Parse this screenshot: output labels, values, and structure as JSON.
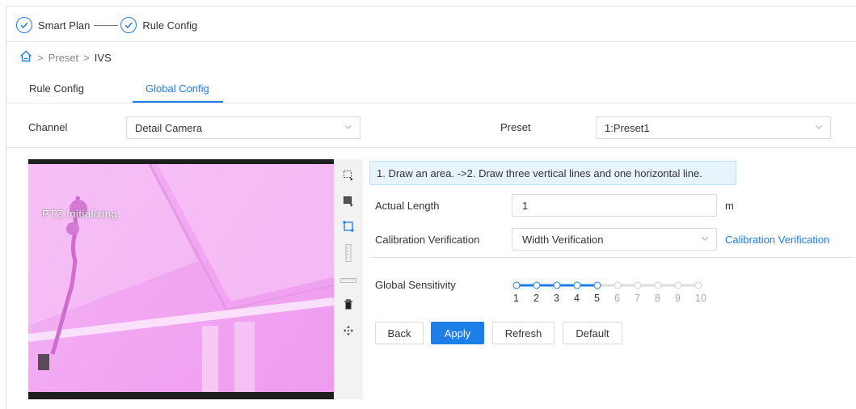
{
  "steps": [
    {
      "label": "Smart Plan"
    },
    {
      "label": "Rule Config"
    }
  ],
  "breadcrumb": {
    "items": [
      "Preset",
      "IVS"
    ],
    "separator": ">"
  },
  "tabs": [
    {
      "label": "Rule Config",
      "active": false
    },
    {
      "label": "Global Config",
      "active": true
    }
  ],
  "form": {
    "channel_label": "Channel",
    "channel_value": "Detail Camera",
    "preset_label": "Preset",
    "preset_value": "1:Preset1"
  },
  "video": {
    "status_text": "PTZ Initializing."
  },
  "toolbar": {
    "icons": [
      "draw-area-icon",
      "select-area-icon",
      "rectangle-icon",
      "vertical-ruler-icon",
      "horizontal-ruler-icon",
      "delete-icon",
      "move-icon"
    ]
  },
  "config": {
    "hint": "1. Draw an area. ->2. Draw three vertical lines and one horizontal line.",
    "actual_length_label": "Actual Length",
    "actual_length_value": "1",
    "actual_length_unit": "m",
    "calibration_label": "Calibration Verification",
    "calibration_value": "Width Verification",
    "calibration_link": "Calibration Verification",
    "sensitivity_label": "Global Sensitivity",
    "sensitivity_value": 5,
    "sensitivity_ticks": [
      "1",
      "2",
      "3",
      "4",
      "5",
      "6",
      "7",
      "8",
      "9",
      "10"
    ]
  },
  "buttons": {
    "back": "Back",
    "apply": "Apply",
    "refresh": "Refresh",
    "default": "Default"
  },
  "colors": {
    "accent": "#1e7ee8",
    "video_tint": "#f2a8f2"
  }
}
